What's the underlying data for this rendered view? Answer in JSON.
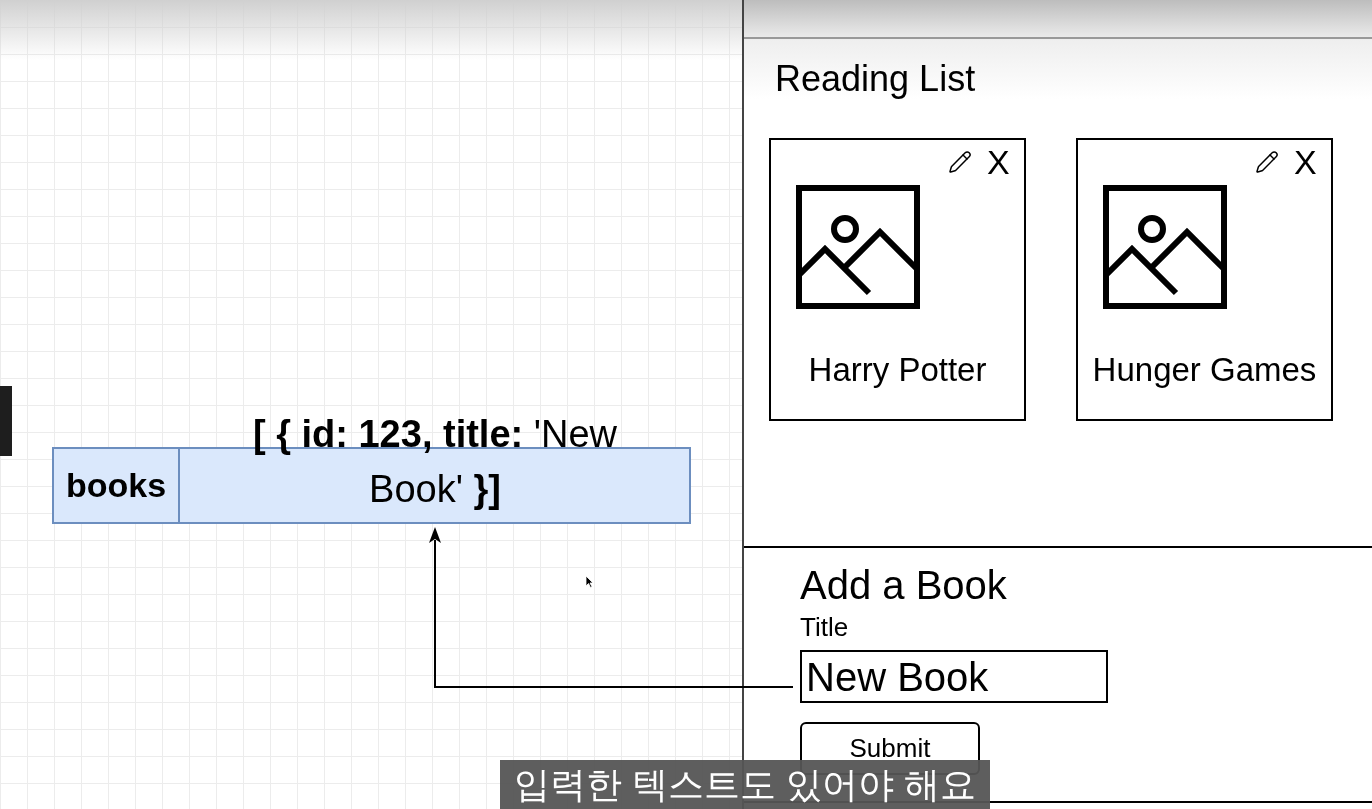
{
  "canvas": {
    "table": {
      "name": "books",
      "value": "**[ { id: 123, title:** 'New Book' **}]**"
    }
  },
  "reading_list": {
    "title": "Reading List",
    "books": [
      {
        "title": "Harry Potter",
        "delete": "X"
      },
      {
        "title": "Hunger Games",
        "delete": "X"
      }
    ]
  },
  "add_book": {
    "title": "Add a Book",
    "field_label": "Title",
    "value": "New Book",
    "button": "Submit"
  },
  "subtitle": "입력한 텍스트도 있어야 해요"
}
